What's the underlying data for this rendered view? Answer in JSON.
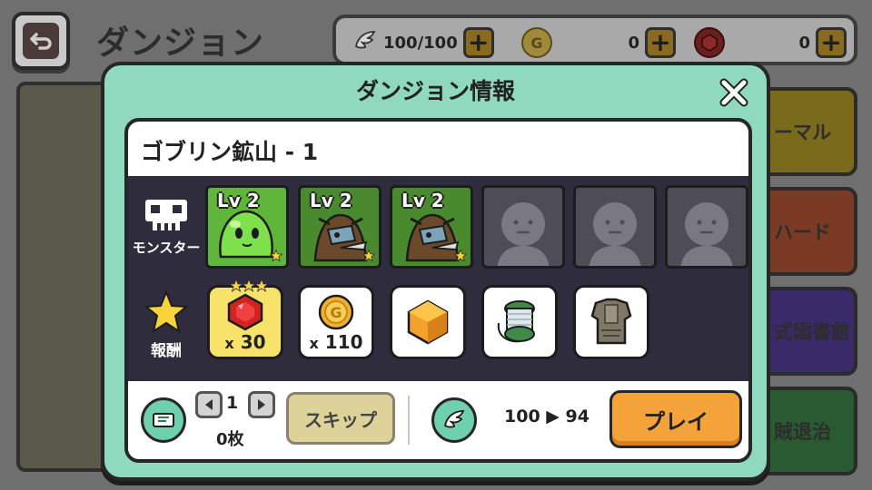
{
  "screen": {
    "title": "ダンジョン",
    "back_icon": "return-arrow-icon"
  },
  "currency": {
    "stamina": "100/100",
    "gold": "0",
    "gems": "0"
  },
  "side_menu": [
    {
      "label": "ーマル",
      "color": "#7a6a1c"
    },
    {
      "label": "ハード",
      "color": "#7a3a24"
    },
    {
      "label": "式図書館",
      "color": "#3a2a6a"
    },
    {
      "label": "賊退治",
      "color": "#2a5a32"
    }
  ],
  "modal": {
    "title": "ダンジョン情報",
    "dungeon_name": "ゴブリン鉱山 - 1",
    "monsters_label": "モンスター",
    "monsters": [
      {
        "level": "Lv 2",
        "kind": "slime",
        "stars": 1
      },
      {
        "level": "Lv 2",
        "kind": "goblin",
        "stars": 1
      },
      {
        "level": "Lv 2",
        "kind": "goblin",
        "stars": 1
      },
      {
        "level": "",
        "kind": "empty"
      },
      {
        "level": "",
        "kind": "empty"
      },
      {
        "level": "",
        "kind": "empty"
      }
    ],
    "rewards_label": "報酬",
    "rewards": [
      {
        "item": "ruby-gem-icon",
        "prefix": "x",
        "qty": "30",
        "highlight": true,
        "stars": 3
      },
      {
        "item": "gold-coin-icon",
        "prefix": "x",
        "qty": "110",
        "highlight": false
      },
      {
        "item": "amber-crystal-icon",
        "highlight": false
      },
      {
        "item": "thread-spool-icon",
        "highlight": false
      },
      {
        "item": "stone-armor-icon",
        "highlight": false
      }
    ],
    "ticket_stepper_value": "1",
    "ticket_count": "0枚",
    "skip_label": "スキップ",
    "stamina_change": "100 ▶ 94",
    "play_label": "プレイ"
  },
  "colors": {
    "modal_bg": "#8fd9bf",
    "play_button": "#f3a33a",
    "slot_filled": "#5fb63a",
    "slot_empty": "#4e4c55"
  }
}
